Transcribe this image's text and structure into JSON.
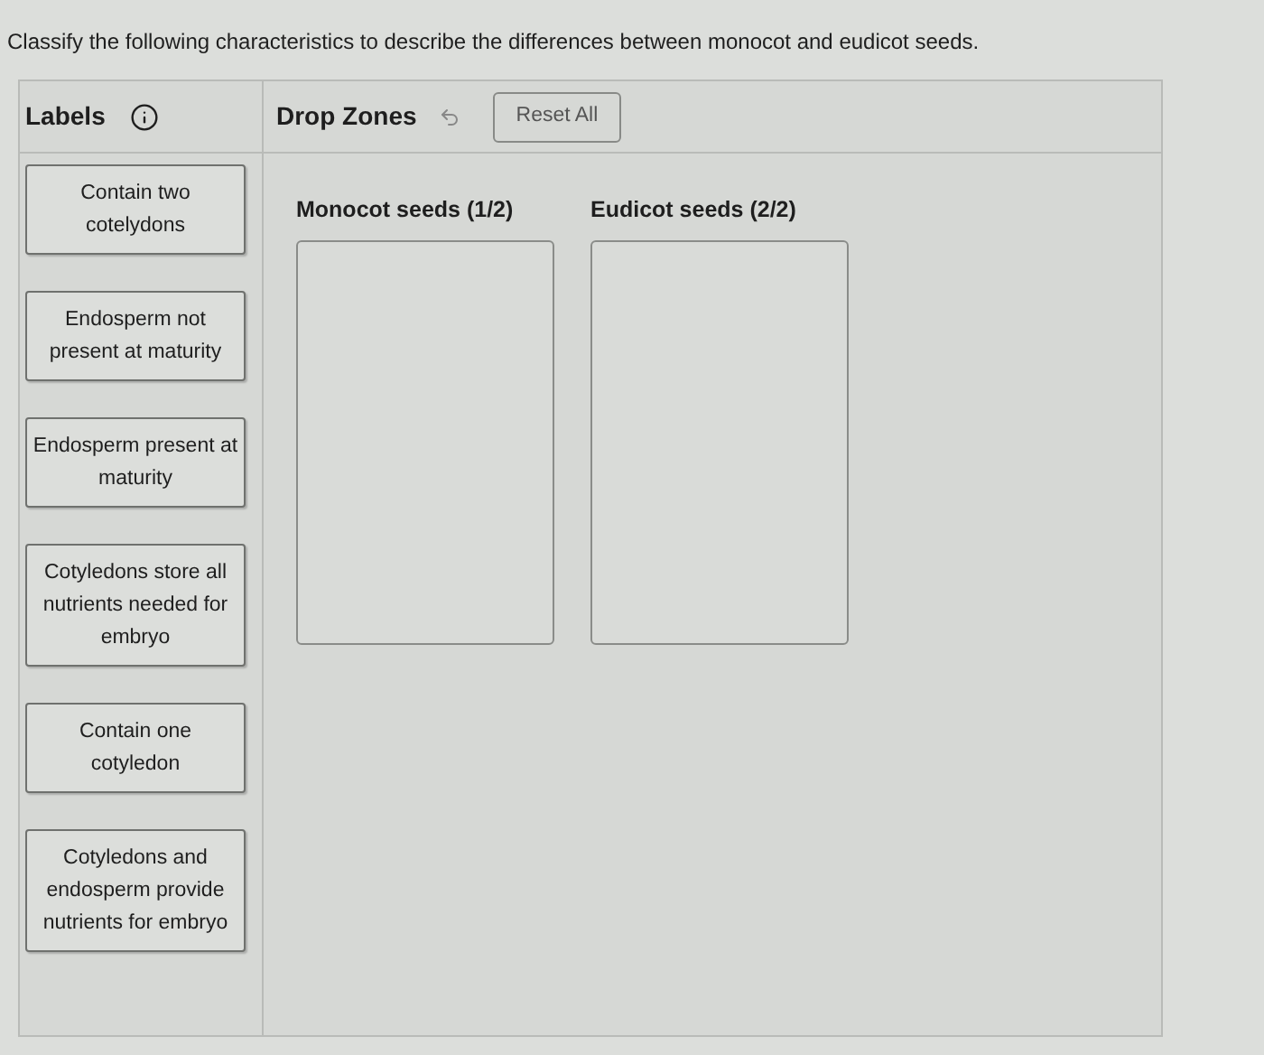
{
  "instruction": "Classify the following characteristics to describe the differences between monocot and eudicot seeds.",
  "labels_panel": {
    "title": "Labels",
    "items": [
      "Contain two cotelydons",
      "Endosperm not present at maturity",
      "Endosperm present at maturity",
      "Cotyledons store all nutrients needed for embryo",
      "Contain one cotyledon",
      "Cotyledons and endosperm provide nutrients for embryo"
    ]
  },
  "drop_panel": {
    "title": "Drop Zones",
    "reset_button": "Reset All",
    "zones": [
      {
        "title": "Monocot seeds (1/2)"
      },
      {
        "title": "Eudicot seeds (2/2)"
      }
    ]
  }
}
